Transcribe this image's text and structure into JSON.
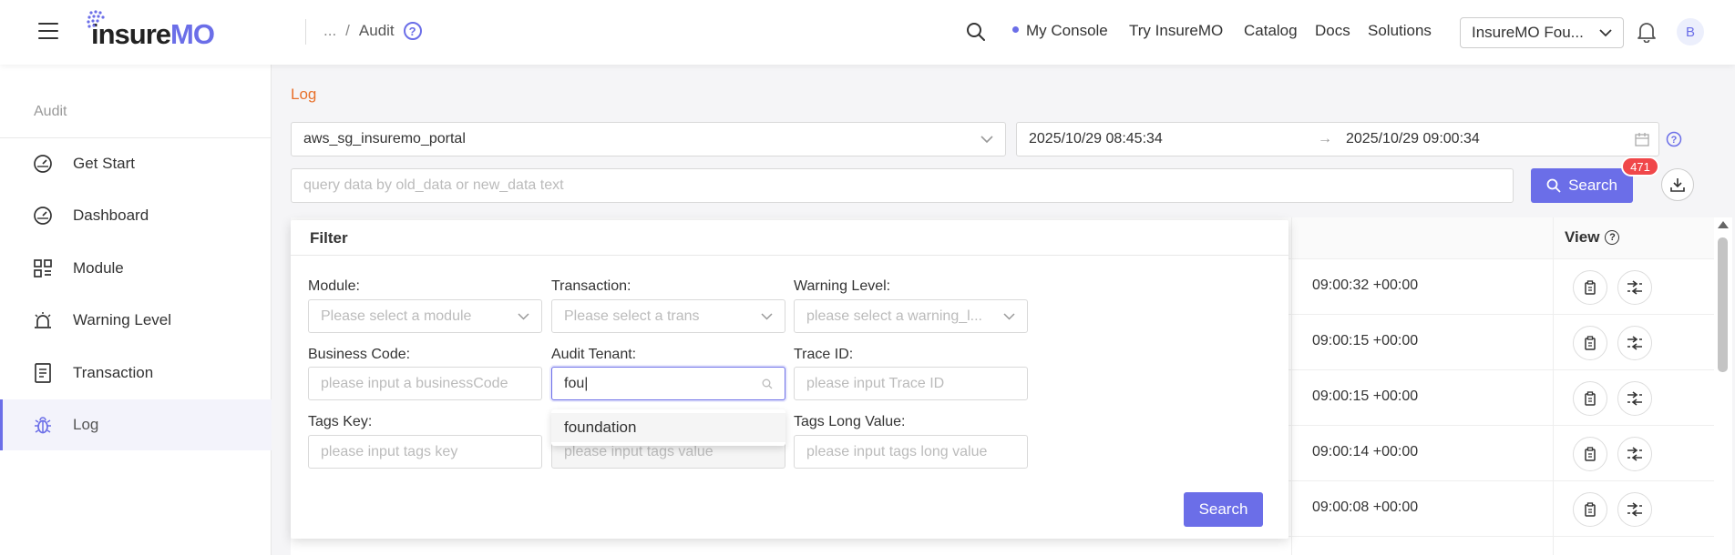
{
  "header": {
    "logo_part1": "insure",
    "logo_part2": "MO",
    "breadcrumb_ellipsis": "...",
    "breadcrumb_sep": "/",
    "breadcrumb_current": "Audit",
    "help_glyph": "?",
    "nav": [
      "My Console",
      "Try InsureMO",
      "Catalog",
      "Docs",
      "Solutions"
    ],
    "tenant_value": "InsureMO Fou...",
    "avatar_initial": "B",
    "accent_color": "#6b6ee8"
  },
  "sidebar": {
    "title": "Audit",
    "items": [
      {
        "label": "Get Start",
        "icon": "gauge-icon"
      },
      {
        "label": "Dashboard",
        "icon": "gauge-icon"
      },
      {
        "label": "Module",
        "icon": "module-grid-icon"
      },
      {
        "label": "Warning Level",
        "icon": "alarm-icon"
      },
      {
        "label": "Transaction",
        "icon": "document-icon"
      },
      {
        "label": "Log",
        "icon": "bug-icon"
      }
    ],
    "active": "Log"
  },
  "main": {
    "page_title": "Log",
    "app_select_value": "aws_sg_insuremo_portal",
    "date_start": "2025/10/29 08:45:34",
    "date_arrow": "→",
    "date_end": "2025/10/29 09:00:34",
    "query_placeholder": "query data by old_data or new_data text",
    "search_label": "Search",
    "result_count": "471",
    "table": {
      "view_header": "View",
      "view_help": "?",
      "rows": [
        {
          "time": "09:00:32 +00:00"
        },
        {
          "time": "09:00:15 +00:00"
        },
        {
          "time": "09:00:15 +00:00"
        },
        {
          "time": "09:00:14 +00:00"
        },
        {
          "time": "09:00:08 +00:00"
        }
      ]
    }
  },
  "filter": {
    "title": "Filter",
    "module_label": "Module:",
    "module_placeholder": "Please select a module",
    "transaction_label": "Transaction:",
    "transaction_placeholder": "Please select a trans",
    "warning_label": "Warning Level:",
    "warning_placeholder": "please select a warning_l...",
    "business_label": "Business Code:",
    "business_placeholder": "please input a businessCode",
    "tenant_label": "Audit Tenant:",
    "tenant_value": "fou",
    "trace_label": "Trace ID:",
    "trace_placeholder": "please input Trace ID",
    "tags_key_label": "Tags Key:",
    "tags_key_placeholder": "please input tags key",
    "tags_value_placeholder": "please input tags value",
    "tags_long_label": "Tags Long Value:",
    "tags_long_placeholder": "please input tags long value",
    "dropdown_option": "foundation",
    "search_label": "Search"
  }
}
